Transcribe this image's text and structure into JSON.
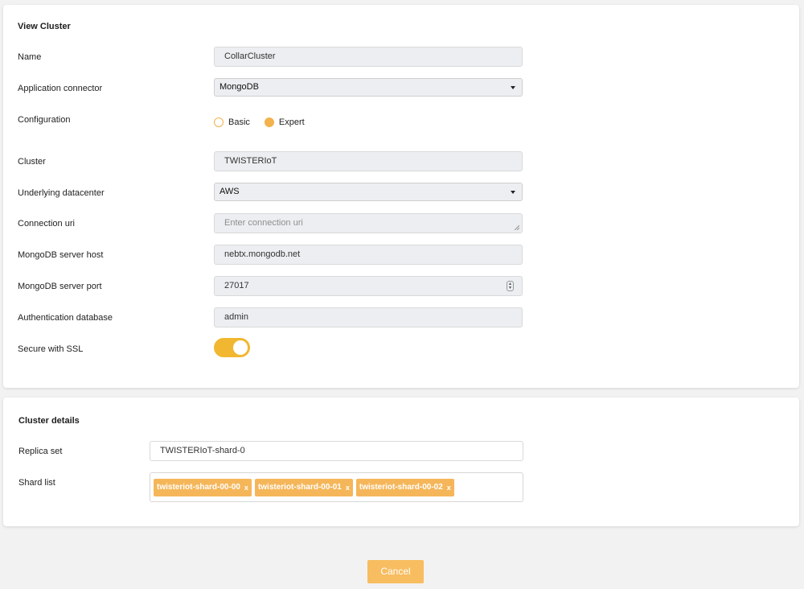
{
  "view_cluster": {
    "title": "View Cluster",
    "name": {
      "label": "Name",
      "value": "CollarCluster"
    },
    "application_connector": {
      "label": "Application connector",
      "value": "MongoDB"
    },
    "configuration": {
      "label": "Configuration",
      "options": [
        "Basic",
        "Expert"
      ],
      "selected": "Expert"
    },
    "cluster": {
      "label": "Cluster",
      "value": "TWISTERIoT"
    },
    "underlying_datacenter": {
      "label": "Underlying datacenter",
      "value": "AWS"
    },
    "connection_uri": {
      "label": "Connection uri",
      "placeholder": "Enter connection uri"
    },
    "server_host": {
      "label": "MongoDB server host",
      "value": "nebtx.mongodb.net"
    },
    "server_port": {
      "label": "MongoDB server port",
      "value": "27017"
    },
    "auth_database": {
      "label": "Authentication database",
      "value": "admin"
    },
    "secure_ssl": {
      "label": "Secure with SSL",
      "enabled": true
    }
  },
  "cluster_details": {
    "title": "Cluster details",
    "replica_set": {
      "label": "Replica set",
      "value": "TWISTERIoT-shard-0"
    },
    "shard_list": {
      "label": "Shard list",
      "tags": [
        "twisteriot-shard-00-00",
        "twisteriot-shard-00-01",
        "twisteriot-shard-00-02"
      ],
      "remove_glyph": "x"
    }
  },
  "footer": {
    "cancel_label": "Cancel"
  },
  "colors": {
    "accent": "#f2b730",
    "tag": "#f5b65a",
    "button": "#f7bd60",
    "field_bg": "#eceef1"
  },
  "icons": {
    "select_caret": "chevron-down-icon",
    "spinner": "number-spinner-icon"
  }
}
